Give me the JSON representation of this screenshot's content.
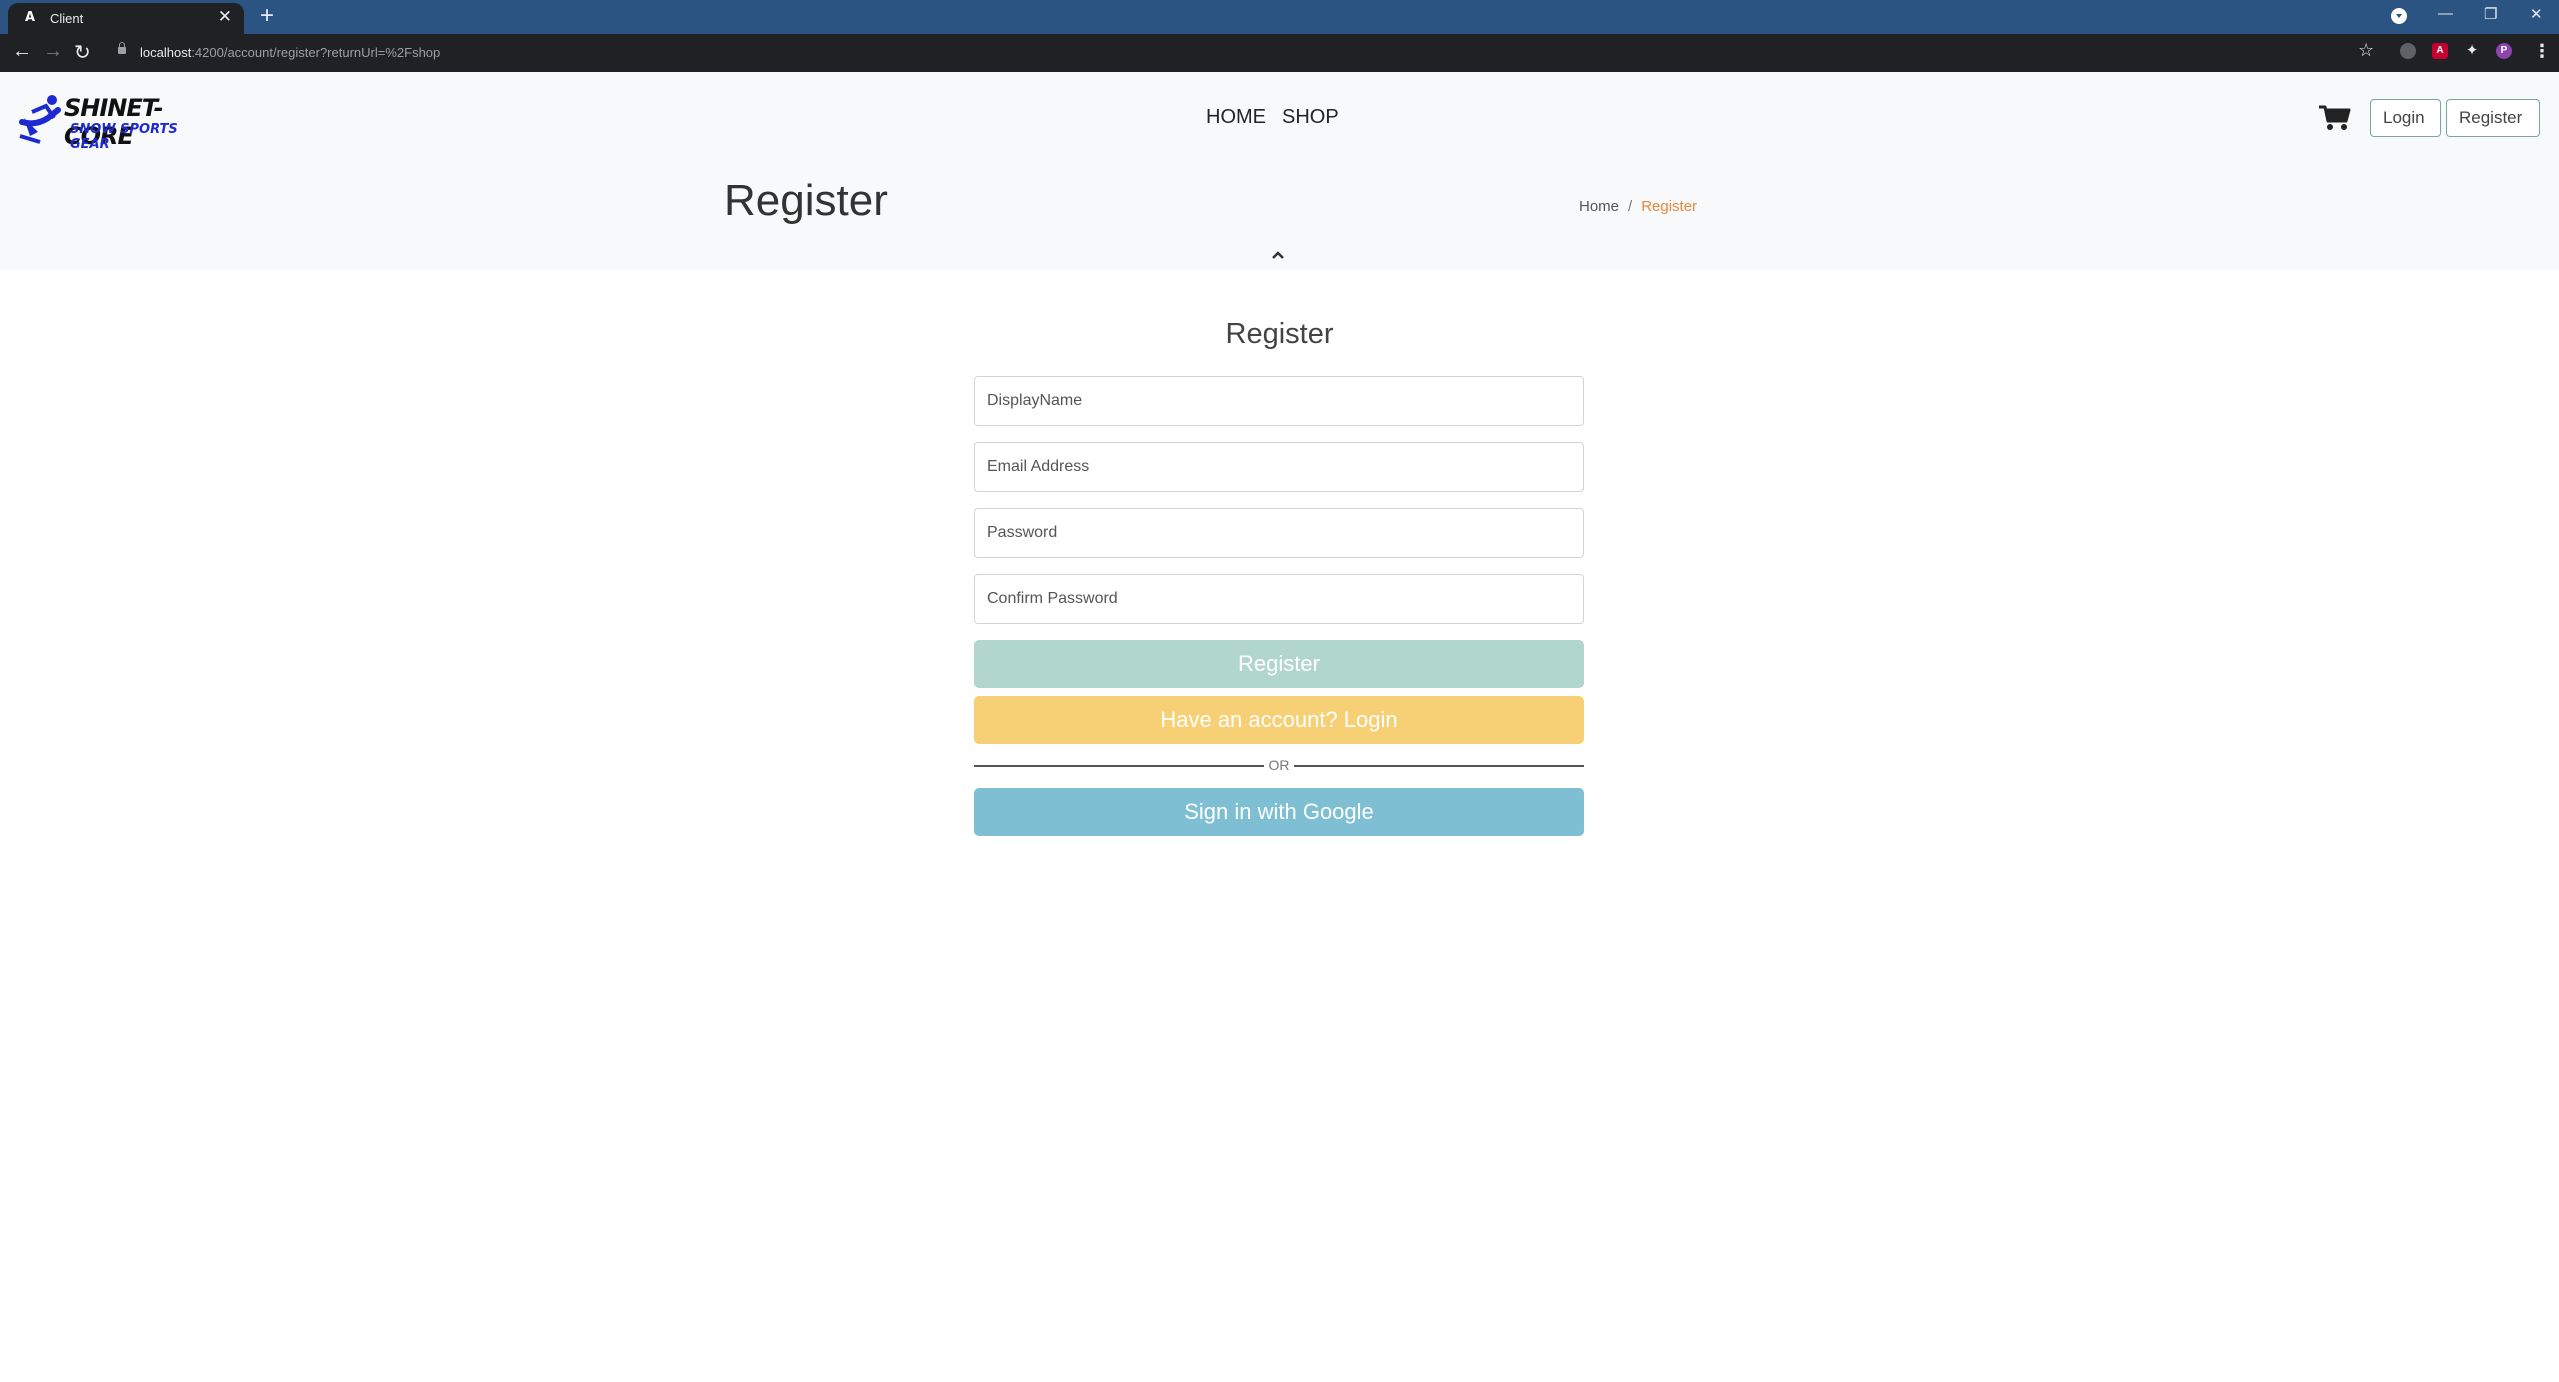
{
  "browser": {
    "tab_title": "Client",
    "tab_favicon": "A",
    "url_host": "localhost",
    "url_rest": ":4200/account/register?returnUrl=%2Fshop",
    "extension_red_label": "A",
    "profile_initial": "P"
  },
  "site": {
    "logo_line1": "SHINET-CORE",
    "logo_line2": "SNOW SPORTS GEAR",
    "nav": [
      "HOME",
      "SHOP"
    ],
    "login_label": "Login",
    "register_label": "Register"
  },
  "section_header": {
    "title": "Register",
    "breadcrumb_home": "Home",
    "breadcrumb_sep": "/",
    "breadcrumb_current": "Register"
  },
  "form": {
    "title": "Register",
    "display_name_placeholder": "DisplayName",
    "email_placeholder": "Email Address",
    "password_placeholder": "Password",
    "confirm_password_placeholder": "Confirm Password",
    "register_button": "Register",
    "login_button": "Have an account? Login",
    "divider_text": "OR",
    "google_button": "Sign in with Google"
  },
  "colors": {
    "accent_orange": "#e8883a",
    "register_button": "#b1d6cc",
    "login_button": "#f7cf74",
    "google_button": "#7fbfd3",
    "tab_bar": "#2c5483"
  }
}
